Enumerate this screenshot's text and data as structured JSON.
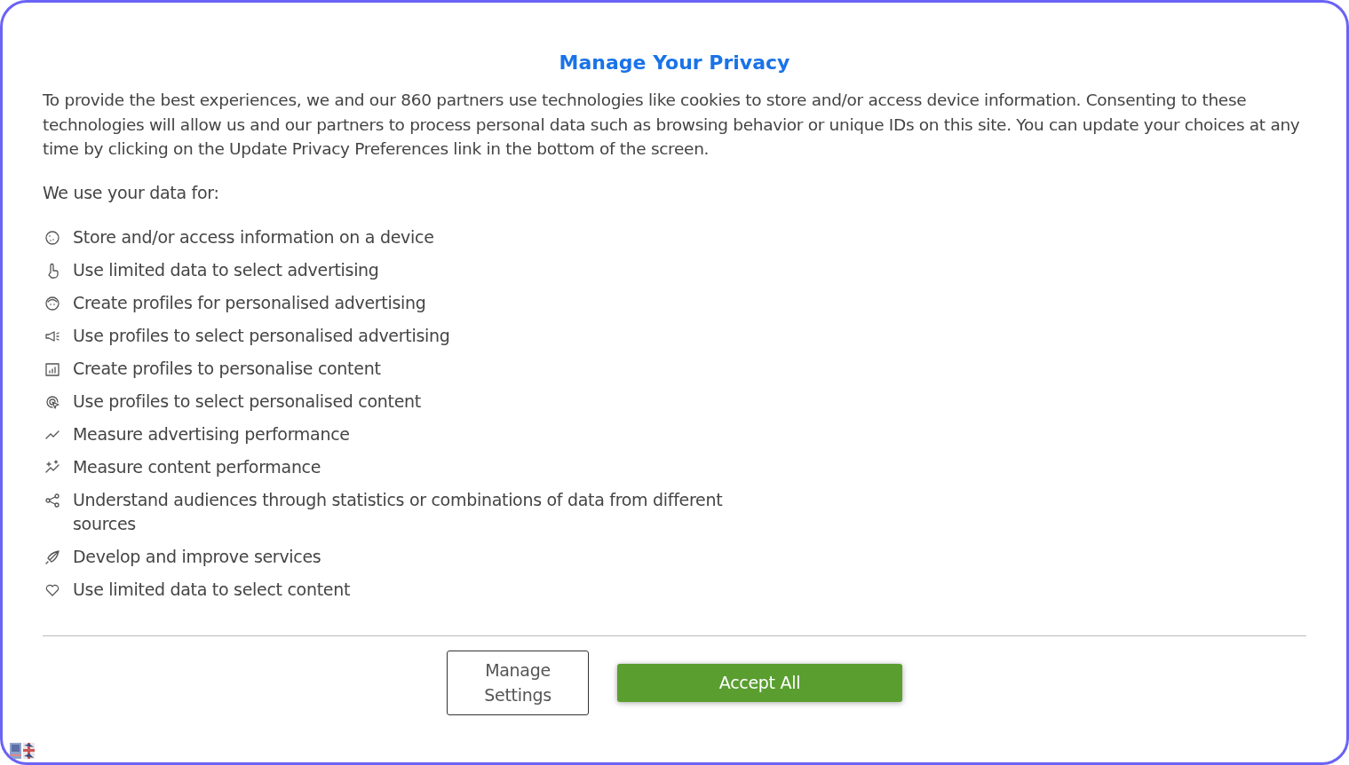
{
  "title": "Manage Your Privacy",
  "intro": "To provide the best experiences, we and our 860 partners use technologies like cookies to store and/or access device information. Consenting to these technologies will allow us and our partners to process personal data such as browsing behavior or unique IDs on this site. You can update your choices at any time by clicking on the Update Privacy Preferences link in the bottom of the screen.",
  "purposes_heading": "We use your data for:",
  "purposes": [
    "Store and/or access information on a device",
    "Use limited data to select advertising",
    "Create profiles for personalised advertising",
    "Use profiles to select personalised advertising",
    "Create profiles to personalise content",
    "Use profiles to select personalised content",
    "Measure advertising performance",
    "Measure content performance",
    "Understand audiences through statistics or combinations of data from different sources",
    "Develop and improve services",
    "Use limited data to select content"
  ],
  "buttons": [
    {
      "label": "Manage Settings",
      "kind": "outline"
    },
    {
      "label": "Accept All",
      "kind": "primary"
    }
  ]
}
